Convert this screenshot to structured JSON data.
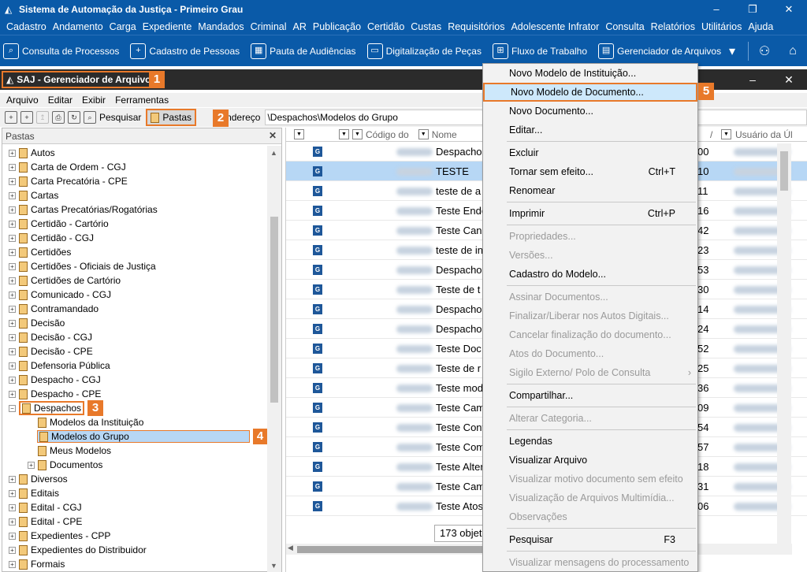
{
  "app": {
    "title": "Sistema de Automação da Justiça - Primeiro Grau",
    "menu": [
      "Cadastro",
      "Andamento",
      "Carga",
      "Expediente",
      "Mandados",
      "Criminal",
      "AR",
      "Publicação",
      "Certidão",
      "Custas",
      "Requisitórios",
      "Adolescente Infrator",
      "Consulta",
      "Relatórios",
      "Utilitários",
      "Ajuda"
    ],
    "quick": [
      {
        "label": "Consulta de Processos",
        "icon": "search-process-icon"
      },
      {
        "label": "Cadastro de Pessoas",
        "icon": "add-person-icon"
      },
      {
        "label": "Pauta de Audiências",
        "icon": "calendar-icon"
      },
      {
        "label": "Digitalização de Peças",
        "icon": "scanner-icon"
      },
      {
        "label": "Fluxo de Trabalho",
        "icon": "workflow-icon"
      },
      {
        "label": "Gerenciador de Arquivos",
        "icon": "file-manager-icon"
      }
    ]
  },
  "child": {
    "title": "SAJ - Gerenciador de Arquivos",
    "menu": [
      "Arquivo",
      "Editar",
      "Exibir",
      "Ferramentas"
    ],
    "toolbar": {
      "search": "Pesquisar",
      "pastas": "Pastas",
      "address_label": "Endereço",
      "address": "\\Despachos\\Modelos do Grupo"
    }
  },
  "badges": [
    "1",
    "2",
    "3",
    "4",
    "5"
  ],
  "folders": {
    "header": "Pastas",
    "items": [
      {
        "label": "Autos",
        "indent": 0,
        "exp": "+"
      },
      {
        "label": "Carta de Ordem - CGJ",
        "indent": 0,
        "exp": "+"
      },
      {
        "label": "Carta Precatória - CPE",
        "indent": 0,
        "exp": "+"
      },
      {
        "label": "Cartas",
        "indent": 0,
        "exp": "+"
      },
      {
        "label": "Cartas Precatórias/Rogatórias",
        "indent": 0,
        "exp": "+"
      },
      {
        "label": "Certidão - Cartório",
        "indent": 0,
        "exp": "+"
      },
      {
        "label": "Certidão - CGJ",
        "indent": 0,
        "exp": "+"
      },
      {
        "label": "Certidões",
        "indent": 0,
        "exp": "+"
      },
      {
        "label": "Certidões - Oficiais de Justiça",
        "indent": 0,
        "exp": "+"
      },
      {
        "label": "Certidões de Cartório",
        "indent": 0,
        "exp": "+"
      },
      {
        "label": "Comunicado - CGJ",
        "indent": 0,
        "exp": "+"
      },
      {
        "label": "Contramandado",
        "indent": 0,
        "exp": "+"
      },
      {
        "label": "Decisão",
        "indent": 0,
        "exp": "+"
      },
      {
        "label": "Decisão - CGJ",
        "indent": 0,
        "exp": "+"
      },
      {
        "label": "Decisão - CPE",
        "indent": 0,
        "exp": "+"
      },
      {
        "label": "Defensoria Pública",
        "indent": 0,
        "exp": "+"
      },
      {
        "label": "Despacho - CGJ",
        "indent": 0,
        "exp": "+"
      },
      {
        "label": "Despacho - CPE",
        "indent": 0,
        "exp": "+"
      },
      {
        "label": "Despachos",
        "indent": 0,
        "exp": "-",
        "mark": "3"
      },
      {
        "label": "Modelos da Instituição",
        "indent": 1,
        "exp": ""
      },
      {
        "label": "Modelos do Grupo",
        "indent": 1,
        "exp": "",
        "mark": "4",
        "selected": true
      },
      {
        "label": "Meus Modelos",
        "indent": 1,
        "exp": ""
      },
      {
        "label": "Documentos",
        "indent": 1,
        "exp": "+"
      },
      {
        "label": "Diversos",
        "indent": 0,
        "exp": "+"
      },
      {
        "label": "Editais",
        "indent": 0,
        "exp": "+"
      },
      {
        "label": "Edital - CGJ",
        "indent": 0,
        "exp": "+"
      },
      {
        "label": "Edital - CPE",
        "indent": 0,
        "exp": "+"
      },
      {
        "label": "Expedientes - CPP",
        "indent": 0,
        "exp": "+"
      },
      {
        "label": "Expedientes do Distribuidor",
        "indent": 0,
        "exp": "+"
      },
      {
        "label": "Formais",
        "indent": 0,
        "exp": "+"
      }
    ]
  },
  "list": {
    "columns": [
      "Código do",
      "Nome",
      "/",
      "Usuário da Úl"
    ],
    "rows": [
      {
        "name": "Despacho",
        "num": "00",
        "icon": "g"
      },
      {
        "name": "TESTE",
        "num": "10",
        "icon": "gh",
        "selected": true
      },
      {
        "name": "teste de a",
        "num": "11",
        "icon": "g"
      },
      {
        "name": "Teste Ende",
        "num": "16",
        "icon": "g"
      },
      {
        "name": "Teste  Can",
        "num": "42",
        "icon": "g"
      },
      {
        "name": "teste de in",
        "num": "23",
        "icon": "gh"
      },
      {
        "name": "Despacho",
        "num": "53",
        "icon": "g"
      },
      {
        "name": "Teste de t",
        "num": "30",
        "icon": "g"
      },
      {
        "name": "Despacho",
        "num": "14",
        "icon": "g"
      },
      {
        "name": "Despacho",
        "num": "24",
        "icon": "g"
      },
      {
        "name": "Teste Doc",
        "num": "52",
        "icon": "g"
      },
      {
        "name": "Teste de r",
        "num": "25",
        "icon": "g"
      },
      {
        "name": "Teste mod",
        "num": "36",
        "icon": "g"
      },
      {
        "name": "Teste Cam",
        "num": "09",
        "icon": "g"
      },
      {
        "name": "Teste Cont",
        "num": "54",
        "icon": "gh"
      },
      {
        "name": "Teste Com",
        "num": "57",
        "icon": "gh"
      },
      {
        "name": "Teste Alter",
        "num": "18",
        "icon": "g"
      },
      {
        "name": "Teste Cam",
        "num": "31",
        "icon": "g"
      },
      {
        "name": "Teste Atos",
        "num": "06",
        "icon": "g"
      }
    ],
    "count": "173 objet"
  },
  "context_menu": {
    "items": [
      {
        "label": "Novo Modelo de Instituição...",
        "enabled": true
      },
      {
        "label": "Novo Modelo de Documento...",
        "enabled": true,
        "highlight": true
      },
      {
        "label": "Novo Documento...",
        "enabled": true
      },
      {
        "label": "Editar...",
        "enabled": true
      },
      {
        "sep": true
      },
      {
        "label": "Excluir",
        "enabled": true
      },
      {
        "label": "Tornar sem efeito...",
        "enabled": true,
        "shortcut": "Ctrl+T"
      },
      {
        "label": "Renomear",
        "enabled": true
      },
      {
        "sep": true
      },
      {
        "label": "Imprimir",
        "enabled": true,
        "shortcut": "Ctrl+P"
      },
      {
        "sep": true
      },
      {
        "label": "Propriedades...",
        "enabled": false
      },
      {
        "label": "Versões...",
        "enabled": false
      },
      {
        "label": "Cadastro do Modelo...",
        "enabled": true
      },
      {
        "sep": true
      },
      {
        "label": "Assinar Documentos...",
        "enabled": false
      },
      {
        "label": "Finalizar/Liberar nos Autos Digitais...",
        "enabled": false
      },
      {
        "label": "Cancelar finalização do documento...",
        "enabled": false
      },
      {
        "label": "Atos do Documento...",
        "enabled": false
      },
      {
        "label": "Sigilo Externo/ Polo de Consulta",
        "enabled": false,
        "submenu": true
      },
      {
        "sep": true
      },
      {
        "label": "Compartilhar...",
        "enabled": true
      },
      {
        "sep": true
      },
      {
        "label": "Alterar Categoria...",
        "enabled": false
      },
      {
        "sep": true
      },
      {
        "label": "Legendas",
        "enabled": true
      },
      {
        "label": "Visualizar Arquivo",
        "enabled": true
      },
      {
        "label": "Visualizar motivo documento sem efeito",
        "enabled": false
      },
      {
        "label": "Visualização de Arquivos Multimídia...",
        "enabled": false
      },
      {
        "label": "Observações",
        "enabled": false
      },
      {
        "sep": true
      },
      {
        "label": "Pesquisar",
        "enabled": true,
        "shortcut": "F3"
      },
      {
        "sep": true
      },
      {
        "label": "Visualizar mensagens do processamento",
        "enabled": false
      }
    ]
  },
  "colors": {
    "accent": "#0a5aa8",
    "highlight": "#e8792a",
    "selection": "#b7d7f5"
  }
}
